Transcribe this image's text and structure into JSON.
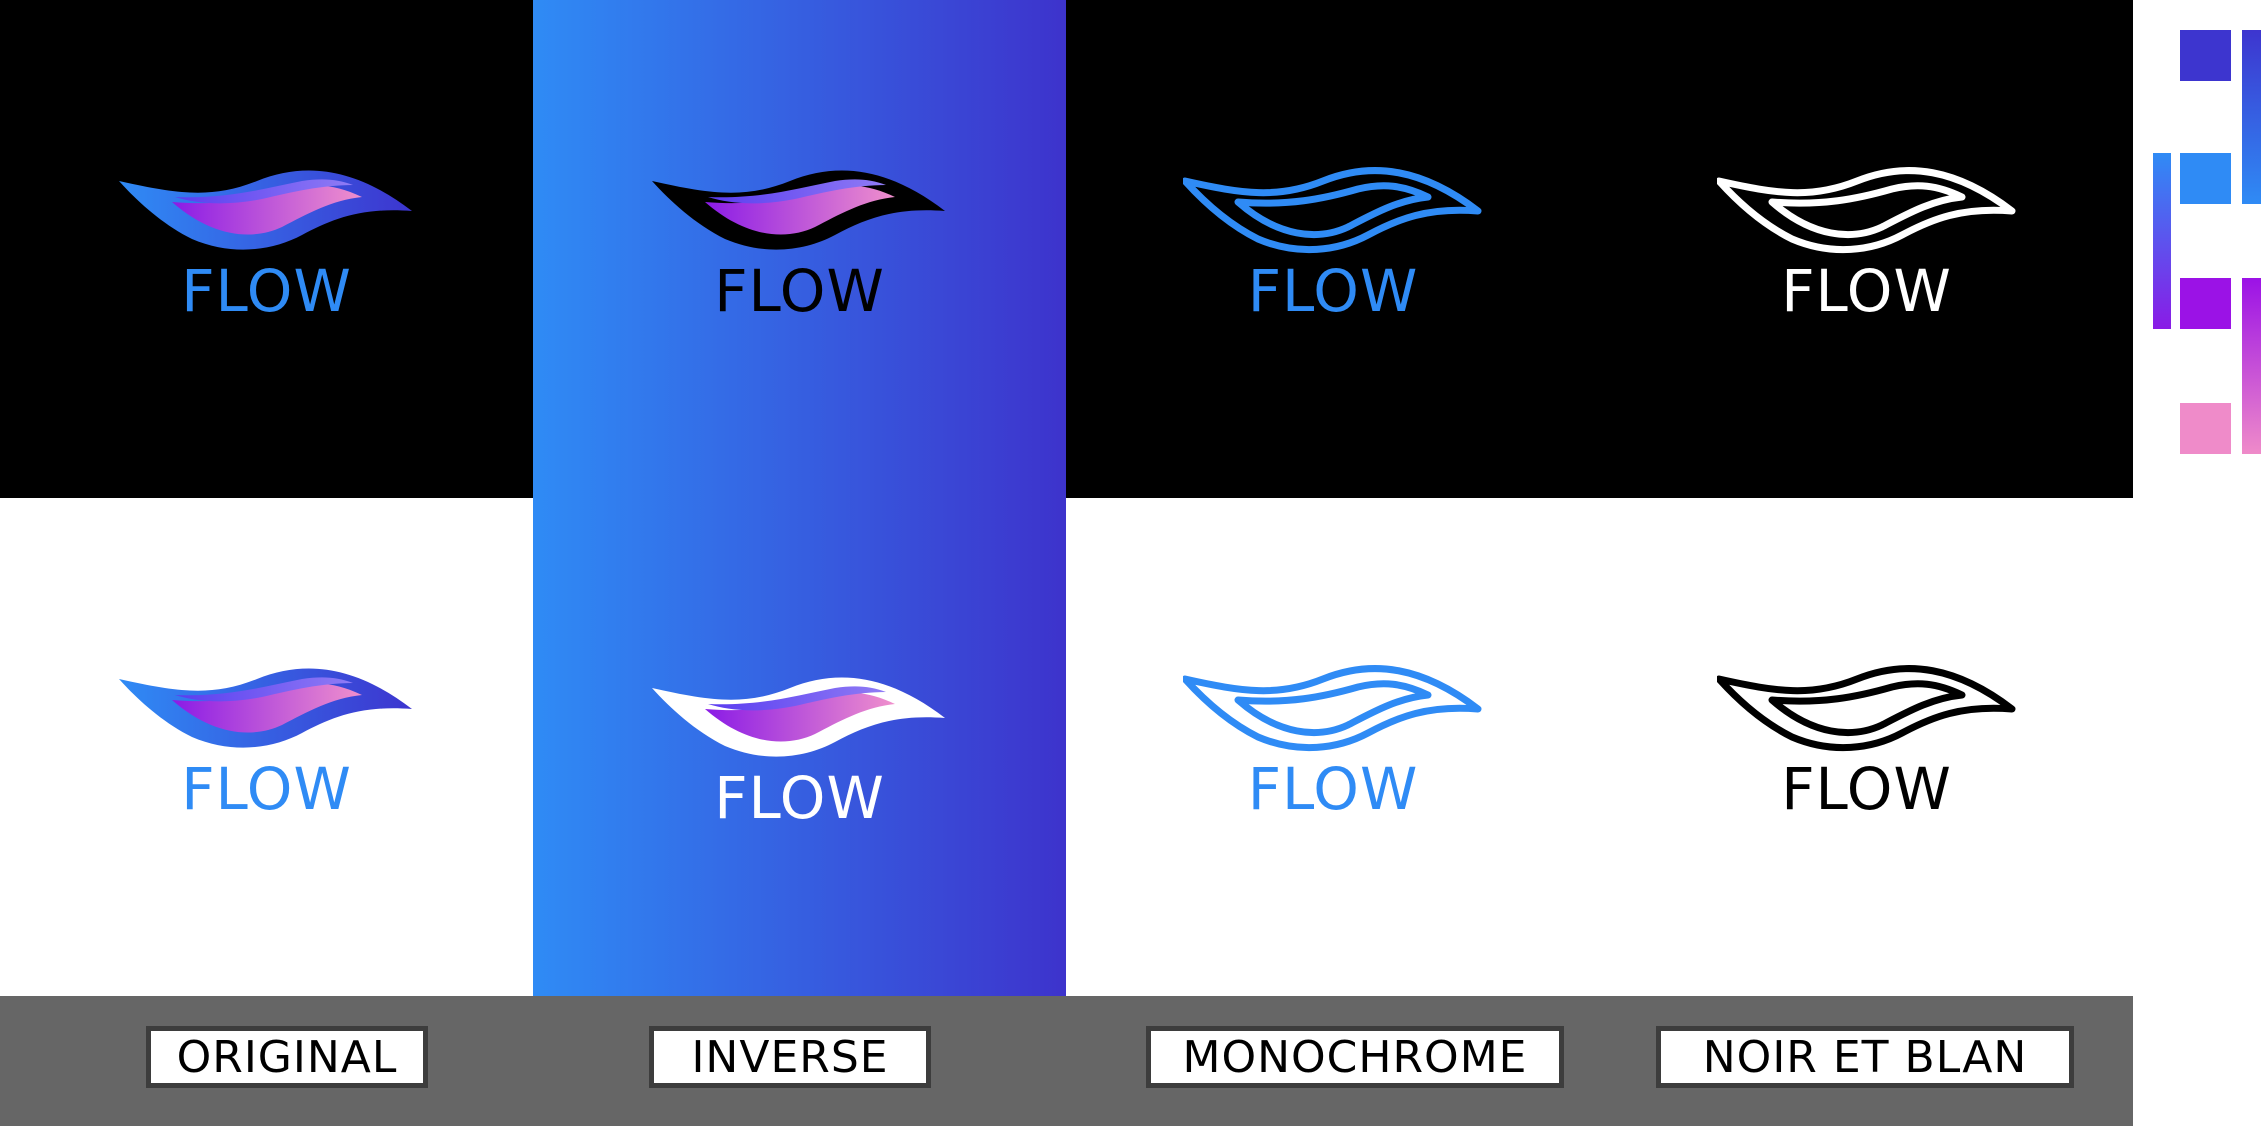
{
  "brand": {
    "wordmark": "FLOW"
  },
  "colors": {
    "blue": "#2f8bf5",
    "indigo": "#3d35cf",
    "purple": "#9b12e6",
    "pink": "#ef8bc9",
    "black": "#000000",
    "white": "#ffffff",
    "bar_gray": "#666666"
  },
  "variants": [
    {
      "label": "ORIGINAL"
    },
    {
      "label": "INVERSE"
    },
    {
      "label": "MONOCHROME"
    },
    {
      "label": "NOIR ET BLAN"
    }
  ],
  "palette": [
    "#3d35cf",
    "#2f8bf5",
    "#9b12e6",
    "#ef8bc9"
  ]
}
